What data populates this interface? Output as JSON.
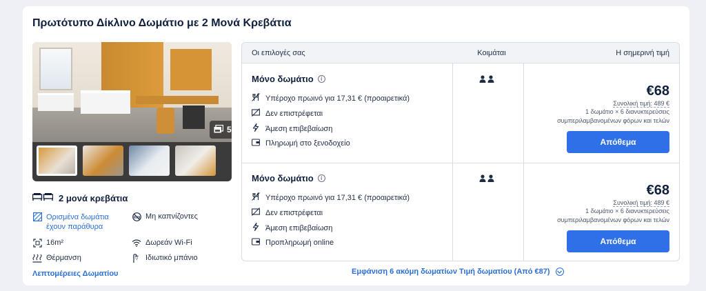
{
  "room": {
    "title": "Πρωτότυπο Δίκλινο Δωμάτιο με 2 Μονά Κρεβάτια",
    "photo_count": "5",
    "beds_label": "2 μονά κρεβάτια",
    "amenities": {
      "window": "Ορισμένα δωμάτια έχουν παράθυρα",
      "no_smoking": "Μη καπνίζοντες",
      "size": "16m²",
      "wifi": "Δωρεάν Wi-Fi",
      "heating": "Θέρμανση",
      "bathroom": "Ιδιωτικό μπάνιο"
    },
    "details_link": "Λεπτομέρειες Δωματίου"
  },
  "table": {
    "headers": {
      "options": "Οι επιλογές σας",
      "sleeps": "Κοιμάται",
      "price": "Η σημερινή τιμή"
    },
    "rows": [
      {
        "name": "Μόνο δωμάτιο",
        "features": [
          "Υπέροχο πρωινό για 17,31 € (προαιρετικά)",
          "Δεν επιστρέφεται",
          "Άμεση επιβεβαίωση",
          "Πληρωμή στο ξενοδοχείο"
        ],
        "guests": 2,
        "price": "€68",
        "total": "Συνολική τιμή: 489 €",
        "nights_line1": "1 δωμάτιο × 6 διανυκτερεύσεις",
        "nights_line2": "συμπεριλαμβανομένων φόρων και τελών",
        "button": "Απόθεμα"
      },
      {
        "name": "Μόνο δωμάτιο",
        "features": [
          "Υπέροχο πρωινό για 17,31 € (προαιρετικά)",
          "Δεν επιστρέφεται",
          "Άμεση επιβεβαίωση",
          "Προπληρωμή online"
        ],
        "guests": 2,
        "price": "€68",
        "total": "Συνολική τιμή: 489 €",
        "nights_line1": "1 δωμάτιο × 6 διανυκτερεύσεις",
        "nights_line2": "συμπεριλαμβανομένων φόρων και τελών",
        "button": "Απόθεμα"
      }
    ]
  },
  "more_rooms": "Εμφάνιση 6 ακόμη δωματίων Τιμή δωματίου (Από €87)",
  "colors": {
    "accent": "#2f6fe8",
    "link": "#2b6fd6",
    "text": "#0f1f3d",
    "background": "#eef0f6"
  },
  "icons": [
    "gallery-icon",
    "bed-icon",
    "window-icon",
    "no-smoking-icon",
    "room-size-icon",
    "wifi-icon",
    "heating-icon",
    "shower-icon",
    "info-icon",
    "breakfast-icon",
    "non-refundable-icon",
    "lightning-icon",
    "wallet-icon",
    "person-icon",
    "chevron-down-icon"
  ]
}
